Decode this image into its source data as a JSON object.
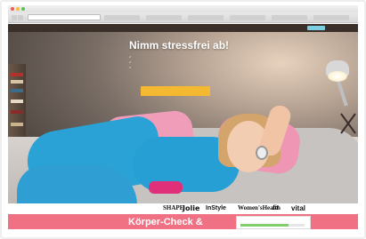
{
  "browser": {
    "window_title": "",
    "address": "",
    "tabs": [
      "",
      "",
      "",
      "",
      "",
      ""
    ]
  },
  "site": {
    "logo": "",
    "nav": [
      "",
      "",
      "",
      ""
    ],
    "header_button": ""
  },
  "hero": {
    "title": "Nimm stressfrei ab!",
    "checklist": [
      "",
      "",
      ""
    ],
    "check_icon": "checkmark-icon",
    "cta_label": ""
  },
  "press": {
    "label": "",
    "logos": [
      "SHAPE",
      "Jolie",
      "InStyle",
      "Women'sHealth",
      "fit",
      "vital"
    ]
  },
  "bottom": {
    "heading": "Körper-Check &",
    "preview_logo": "",
    "preview_progress_fraction": 0.75
  },
  "colors": {
    "cta_yellow": "#f5b931",
    "bottom_pink": "#f07183",
    "header_brown": "#3b2f2a",
    "header_button_blue": "#7ccfe0"
  }
}
